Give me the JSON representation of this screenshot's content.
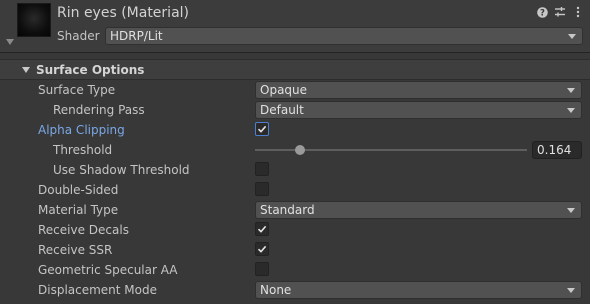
{
  "material": {
    "title": "Rin eyes (Material)",
    "shader_label": "Shader",
    "shader_value": "HDRP/Lit"
  },
  "header_icons": [
    "help-icon",
    "presets-icon",
    "kebab-menu-icon"
  ],
  "section": {
    "title": "Surface Options"
  },
  "fields": {
    "surface_type": {
      "label": "Surface Type",
      "value": "Opaque"
    },
    "rendering_pass": {
      "label": "Rendering Pass",
      "value": "Default"
    },
    "alpha_clipping": {
      "label": "Alpha Clipping",
      "checked": true
    },
    "threshold": {
      "label": "Threshold",
      "value": "0.164",
      "fraction": 0.164
    },
    "use_shadow_threshold": {
      "label": "Use Shadow Threshold",
      "checked": false
    },
    "double_sided": {
      "label": "Double-Sided",
      "checked": false
    },
    "material_type": {
      "label": "Material Type",
      "value": "Standard"
    },
    "receive_decals": {
      "label": "Receive Decals",
      "checked": true
    },
    "receive_ssr": {
      "label": "Receive SSR",
      "checked": true
    },
    "geometric_specular_aa": {
      "label": "Geometric Specular AA",
      "checked": false
    },
    "displacement_mode": {
      "label": "Displacement Mode",
      "value": "None"
    }
  },
  "colors": {
    "accent_label": "#7aa7e6",
    "background": "#383838",
    "dropdown": "#515151"
  }
}
